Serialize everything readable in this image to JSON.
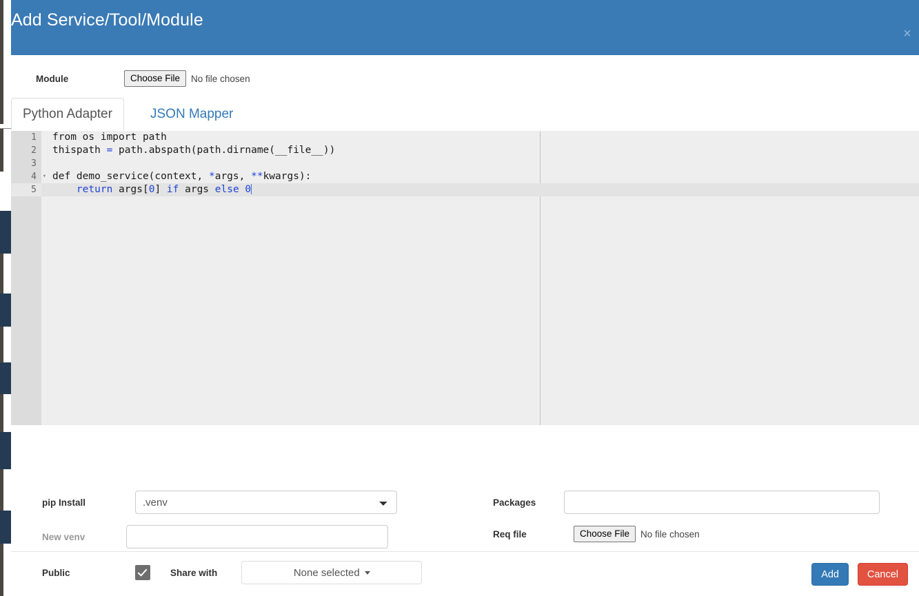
{
  "header": {
    "title": "Add Service/Tool/Module",
    "close_icon": "close-icon",
    "close_glyph": "×",
    "accent_color": "#3a7ab5"
  },
  "module_row": {
    "label": "Module",
    "choose_file_label": "Choose File",
    "file_status": "No file chosen"
  },
  "tabs": [
    {
      "label": "Python Adapter",
      "active": true
    },
    {
      "label": "JSON Mapper",
      "active": false
    }
  ],
  "editor": {
    "active_line": 5,
    "gutter": [
      {
        "num": "1",
        "fold": ""
      },
      {
        "num": "2",
        "fold": ""
      },
      {
        "num": "3",
        "fold": ""
      },
      {
        "num": "4",
        "fold": "▾"
      },
      {
        "num": "5",
        "fold": ""
      }
    ],
    "lines": [
      "from os import path",
      "thispath = path.abspath(path.dirname(__file__))",
      "",
      "def demo_service(context, *args, **kwargs):",
      "    return args[0] if args else 0"
    ]
  },
  "form": {
    "pip_install": {
      "label": "pip Install",
      "selected": ".venv"
    },
    "new_venv": {
      "label": "New venv",
      "value": "",
      "placeholder": ""
    },
    "public": {
      "label": "Public",
      "checked": true
    },
    "share_with": {
      "label": "Share with",
      "value": "None selected"
    },
    "packages": {
      "label": "Packages",
      "value": "",
      "placeholder": ""
    },
    "req_file": {
      "label": "Req file",
      "choose_file_label": "Choose File",
      "file_status": "No file chosen"
    }
  },
  "footer": {
    "add_label": "Add",
    "cancel_label": "Cancel",
    "add_color": "#337ab7",
    "cancel_color": "#e15241"
  }
}
